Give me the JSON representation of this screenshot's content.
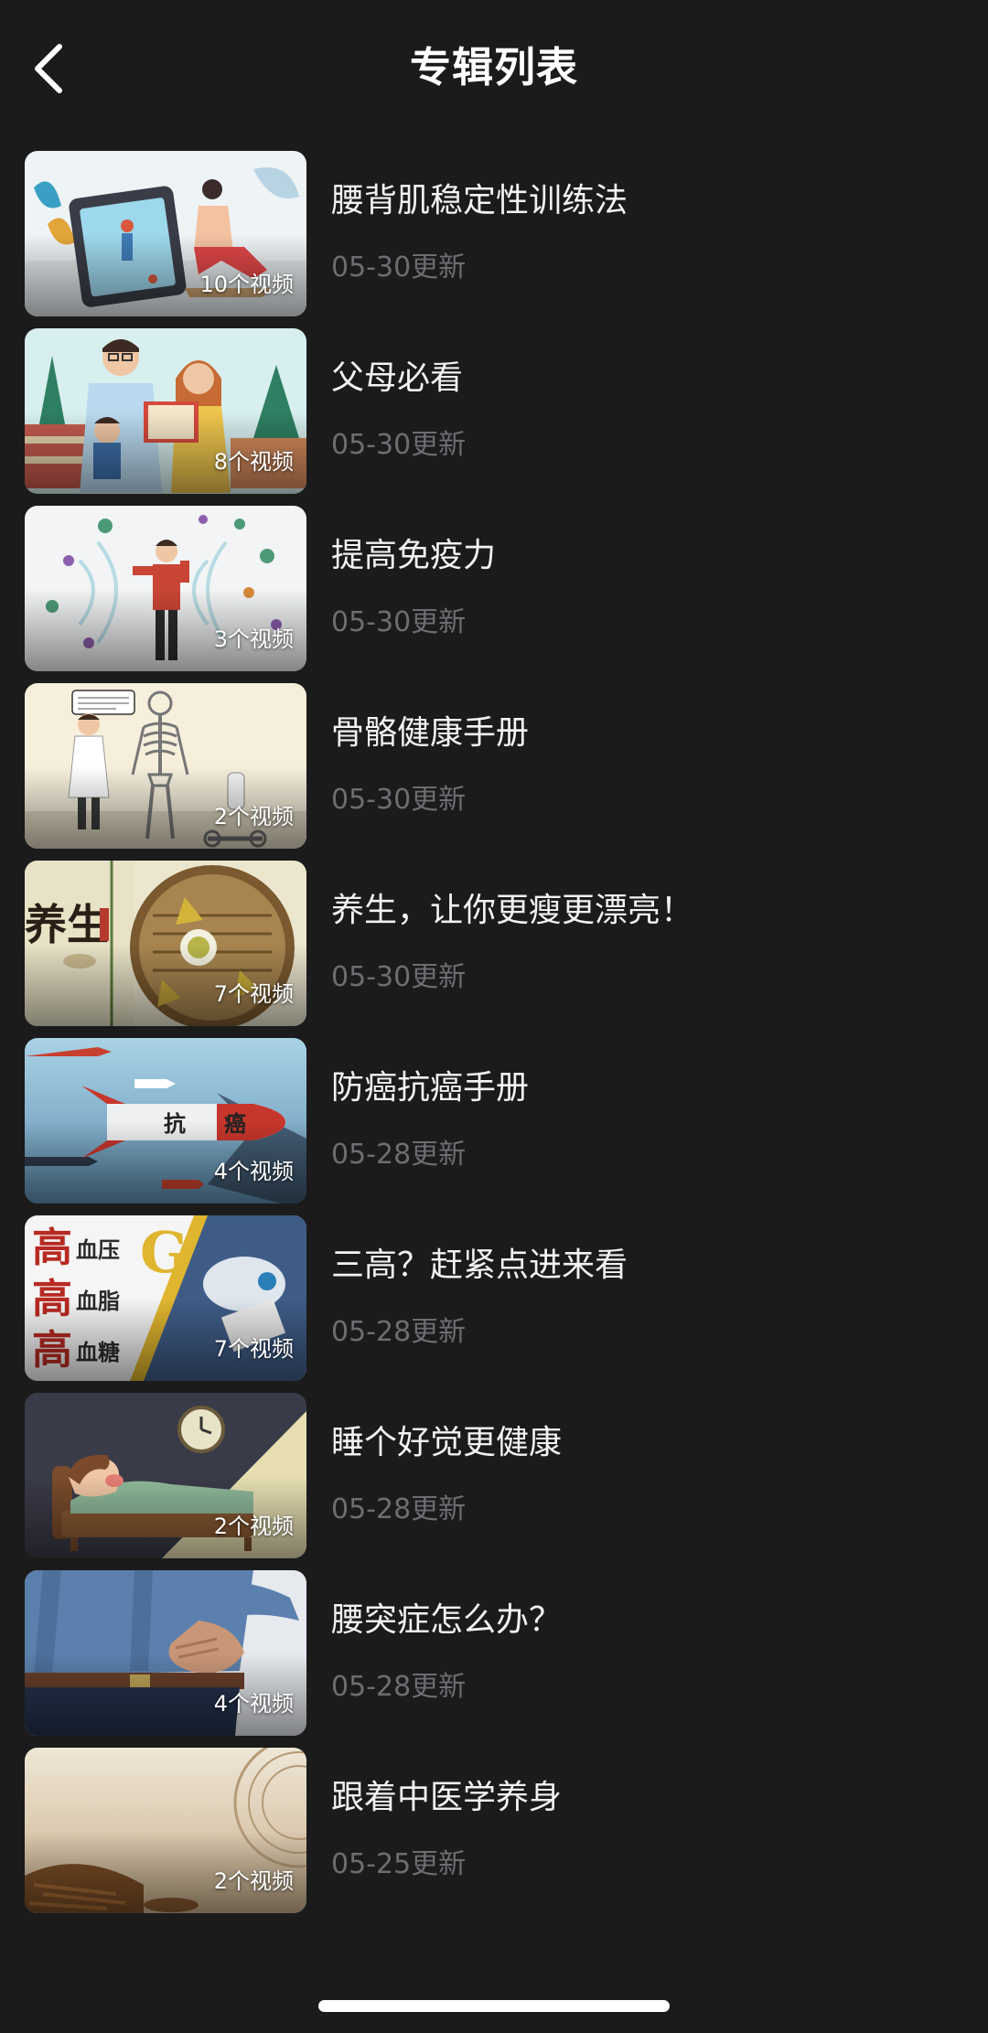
{
  "header": {
    "title": "专辑列表",
    "back_icon": "chevron-left-icon"
  },
  "albums": [
    {
      "title": "腰背肌稳定性训练法",
      "update": "05-30更新",
      "count": "10个视频",
      "thumb": "exercise-tablet-illustration"
    },
    {
      "title": "父母必看",
      "update": "05-30更新",
      "count": "8个视频",
      "thumb": "family-reading-illustration"
    },
    {
      "title": "提高免疫力",
      "update": "05-30更新",
      "count": "3个视频",
      "thumb": "immunity-virus-illustration"
    },
    {
      "title": "骨骼健康手册",
      "update": "05-30更新",
      "count": "2个视频",
      "thumb": "doctor-skeleton-illustration"
    },
    {
      "title": "养生，让你更瘦更漂亮！",
      "update": "05-30更新",
      "count": "7个视频",
      "thumb": "wellness-tea-illustration"
    },
    {
      "title": "防癌抗癌手册",
      "update": "05-28更新",
      "count": "4个视频",
      "thumb": "anticancer-rocket-illustration"
    },
    {
      "title": "三高？赶紧点进来看",
      "update": "05-28更新",
      "count": "7个视频",
      "thumb": "three-highs-banner"
    },
    {
      "title": "睡个好觉更健康",
      "update": "05-28更新",
      "count": "2个视频",
      "thumb": "sleeping-illustration"
    },
    {
      "title": "腰突症怎么办？",
      "update": "05-28更新",
      "count": "4个视频",
      "thumb": "back-pain-photo"
    },
    {
      "title": "跟着中医学养身",
      "update": "05-25更新",
      "count": "2个视频",
      "thumb": "tcm-herbs-photo"
    }
  ],
  "thumb_text": {
    "yangsheng": "养生",
    "rocket_left": "抗",
    "rocket_right": "癌",
    "gao": "高",
    "xueya": "血压",
    "xuezhi": "血脂",
    "xuetang": "血糖",
    "g_letter": "G"
  },
  "colors": {
    "background": "#1b1b1c",
    "title_text": "#f2f2f2",
    "secondary_text": "#6d6d72"
  }
}
